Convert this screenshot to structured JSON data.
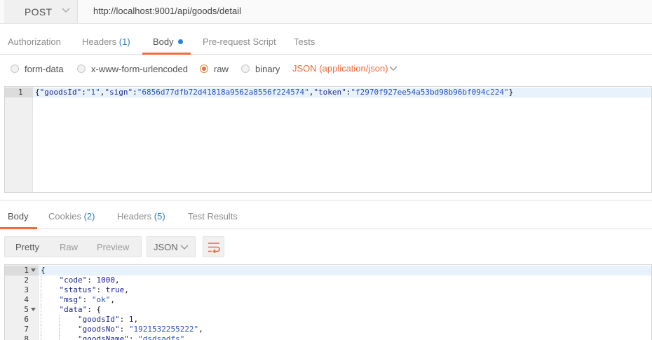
{
  "request": {
    "method": "POST",
    "url": "http://localhost:9001/api/goods/detail"
  },
  "request_tabs": {
    "authorization": "Authorization",
    "headers": "Headers",
    "headers_count": "(1)",
    "body": "Body",
    "pre_request_script": "Pre-request Script",
    "tests": "Tests"
  },
  "body_types": {
    "form_data": "form-data",
    "urlencoded": "x-www-form-urlencoded",
    "raw": "raw",
    "binary": "binary",
    "selected": "raw",
    "content_type": "JSON (application/json)"
  },
  "request_body": {
    "line_number": "1",
    "text": "{\"goodsId\":\"1\",\"sign\":\"6856d77dfb72d41818a9562a8556f224574\",\"token\":\"f2970f927ee54a53bd98b96bf094c224\"}"
  },
  "response_tabs": {
    "body": "Body",
    "cookies": "Cookies",
    "cookies_count": "(2)",
    "headers": "Headers",
    "headers_count": "(5)",
    "test_results": "Test Results"
  },
  "response_view": {
    "pretty": "Pretty",
    "raw": "Raw",
    "preview": "Preview",
    "format": "JSON"
  },
  "response_lines": [
    {
      "no": "1",
      "text": "{",
      "fold": true
    },
    {
      "no": "2",
      "text": "    \"code\": 1000,",
      "fold": false
    },
    {
      "no": "3",
      "text": "    \"status\": true,",
      "fold": false
    },
    {
      "no": "4",
      "text": "    \"msg\": \"ok\",",
      "fold": false
    },
    {
      "no": "5",
      "text": "    \"data\": {",
      "fold": true
    },
    {
      "no": "6",
      "text": "        \"goodsId\": 1,",
      "fold": false
    },
    {
      "no": "7",
      "text": "        \"goodsNo\": \"1921532255222\",",
      "fold": false
    },
    {
      "no": "8",
      "text": "        \"goodsName\": \"dsdsadfs\",",
      "fold": false
    }
  ],
  "colors": {
    "accent": "#f26b3a",
    "count_blue": "#2f80c0",
    "dot_blue": "#2f7fe0"
  }
}
